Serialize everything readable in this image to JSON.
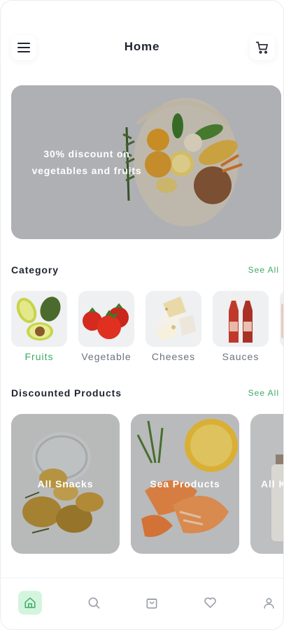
{
  "header": {
    "title": "Home"
  },
  "banner": {
    "text": "30% discount on vegetables and fruits"
  },
  "category_section": {
    "title": "Category",
    "see_all": "See All"
  },
  "categories": [
    {
      "label": "Fruits",
      "active": true
    },
    {
      "label": "Vegetable",
      "active": false
    },
    {
      "label": "Cheeses",
      "active": false
    },
    {
      "label": "Sauces",
      "active": false
    }
  ],
  "discounted_section": {
    "title": "Discounted Products",
    "see_all": "See All"
  },
  "products": [
    {
      "label": "All Snacks"
    },
    {
      "label": "Sea Products"
    },
    {
      "label": "All K"
    }
  ],
  "bottom_nav": [
    {
      "icon": "home-icon",
      "active": true
    },
    {
      "icon": "search-icon",
      "active": false
    },
    {
      "icon": "bag-icon",
      "active": false
    },
    {
      "icon": "heart-icon",
      "active": false
    },
    {
      "icon": "user-icon",
      "active": false
    }
  ],
  "colors": {
    "accent": "#3ea866",
    "nav_active_bg": "#d3f5dd",
    "muted": "#6b7280",
    "text": "#1f2430"
  }
}
